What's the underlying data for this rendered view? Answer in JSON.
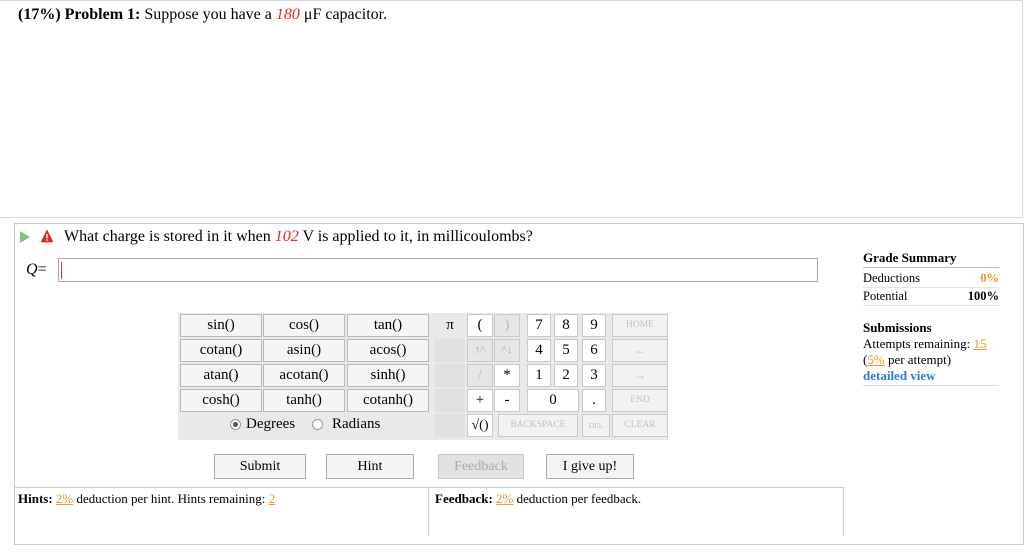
{
  "problem": {
    "prefix": "(17%) Problem 1:",
    "text_before": "Suppose you have a",
    "capacitance": "180",
    "text_after": "μF capacitor."
  },
  "question": {
    "text_before": "What charge is stored in it when",
    "voltage": "102",
    "text_after": "V is applied to it, in millicoulombs?",
    "var_label": "Q",
    "equals": "=",
    "answer_value": ""
  },
  "grade_summary": {
    "title": "Grade Summary",
    "deductions_label": "Deductions",
    "deductions_value": "0%",
    "potential_label": "Potential",
    "potential_value": "100%"
  },
  "submissions": {
    "title": "Submissions",
    "attempts_label": "Attempts remaining:",
    "attempts_value": "15",
    "per_attempt_open": "(",
    "per_attempt_value": "5%",
    "per_attempt_text": "per attempt)",
    "detailed_view": "detailed view"
  },
  "calculator": {
    "functions": [
      [
        "sin()",
        "cos()",
        "tan()"
      ],
      [
        "cotan()",
        "asin()",
        "acos()"
      ],
      [
        "atan()",
        "acotan()",
        "sinh()"
      ],
      [
        "cosh()",
        "tanh()",
        "cotanh()"
      ]
    ],
    "angle_units": {
      "degrees": "Degrees",
      "radians": "Radians",
      "selected": "Degrees"
    },
    "keys": {
      "pi": "π",
      "lparen": "(",
      "rparen": ")",
      "seven": "7",
      "eight": "8",
      "nine": "9",
      "home": "HOME",
      "up": "↑^",
      "down": "^↓",
      "four": "4",
      "five": "5",
      "six": "6",
      "left": "←",
      "slash": "/",
      "star": "*",
      "one": "1",
      "two": "2",
      "three": "3",
      "right": "→",
      "plus": "+",
      "minus": "-",
      "zero": "0",
      "dot": ".",
      "end": "END",
      "sqrt": "√()",
      "backspace": "BACKSPACE",
      "del": "DEL",
      "clear": "CLEAR"
    }
  },
  "buttons": {
    "submit": "Submit",
    "hint": "Hint",
    "feedback": "Feedback",
    "give_up": "I give up!"
  },
  "hints": {
    "label": "Hints:",
    "percent": "2%",
    "text": "deduction per hint. Hints remaining:",
    "remaining": "2"
  },
  "feedback": {
    "label": "Feedback:",
    "percent": "2%",
    "text": "deduction per feedback."
  },
  "colors": {
    "accent_red": "#e8252a",
    "orange": "#f7931e",
    "link_blue": "#2b7cd3",
    "play_green": "#7ec77e"
  }
}
